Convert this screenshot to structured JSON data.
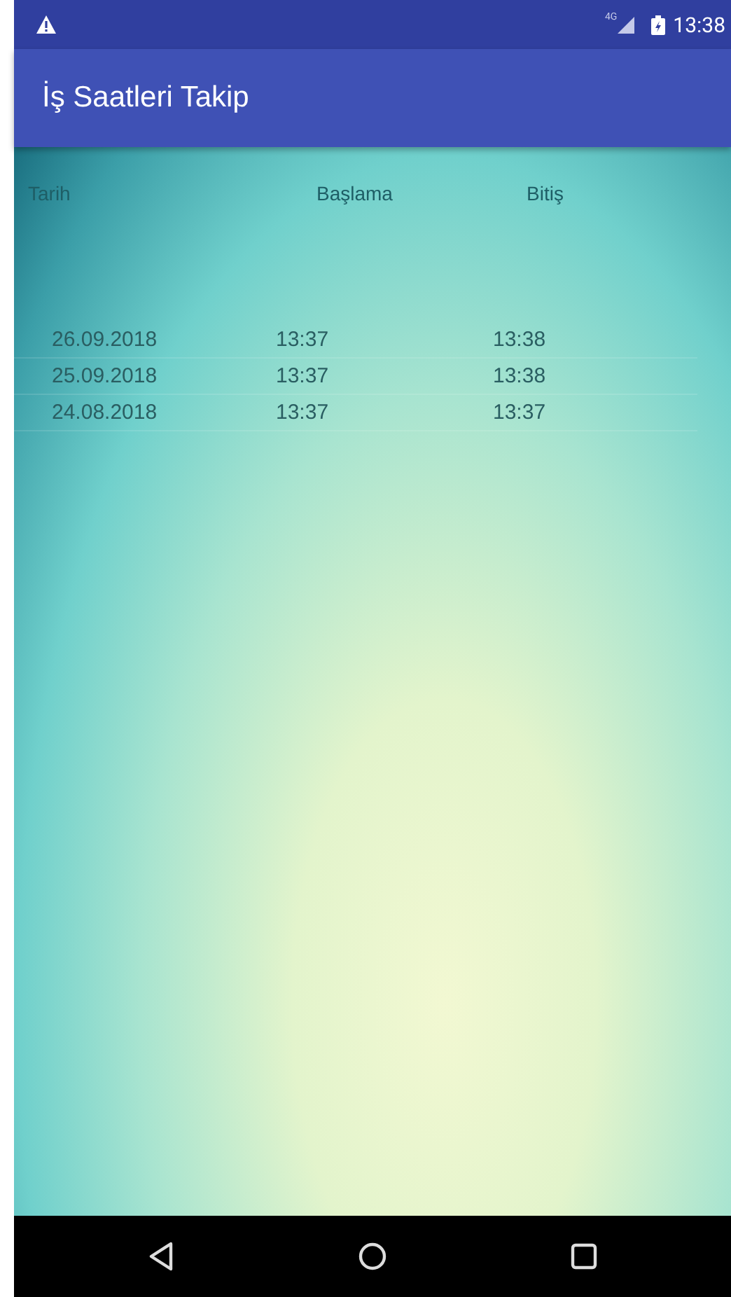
{
  "status_bar": {
    "time": "13:38",
    "network": "4G"
  },
  "app_bar": {
    "title": "İş Saatleri Takip"
  },
  "table": {
    "columns": [
      "Tarih",
      "Başlama",
      "Bitiş"
    ],
    "rows": [
      {
        "date": "26.09.2018",
        "start": "13:37",
        "end": "13:38"
      },
      {
        "date": "25.09.2018",
        "start": "13:37",
        "end": "13:38"
      },
      {
        "date": "24.08.2018",
        "start": "13:37",
        "end": "13:37"
      }
    ]
  }
}
